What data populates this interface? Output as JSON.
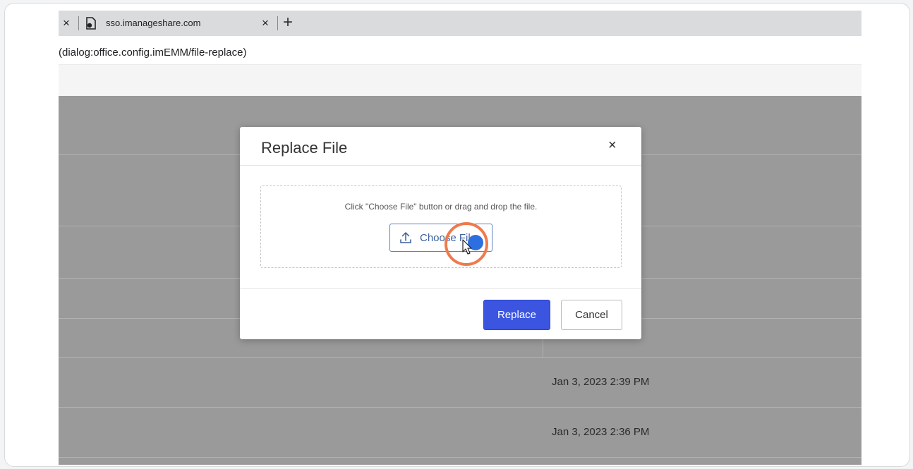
{
  "browser": {
    "tab_title": "sso.imanageshare.com",
    "tab_close_glyph": "×",
    "new_tab_glyph": "+",
    "address_text": "(dialog:office.config.imEMM/file-replace)"
  },
  "table": {
    "rows": [
      {
        "date": "Jan 3, 2023 2:39 PM"
      },
      {
        "date": "Jan 3, 2023 2:36 PM"
      }
    ]
  },
  "dialog": {
    "title": "Replace File",
    "close_glyph": "×",
    "hint": "Click \"Choose File\" button or drag and drop the file.",
    "choose_button_label": "Choose File",
    "replace_button_label": "Replace",
    "cancel_button_label": "Cancel"
  },
  "colors": {
    "primary_button": "#3b55e0",
    "click_highlight_ring": "#ee7a4d",
    "click_indicator": "#2d6fe0",
    "overlay": "#9a9a9a"
  },
  "icons": [
    "close-icon",
    "file-favicon-icon",
    "new-tab-icon",
    "upload-icon",
    "mouse-cursor-icon"
  ]
}
